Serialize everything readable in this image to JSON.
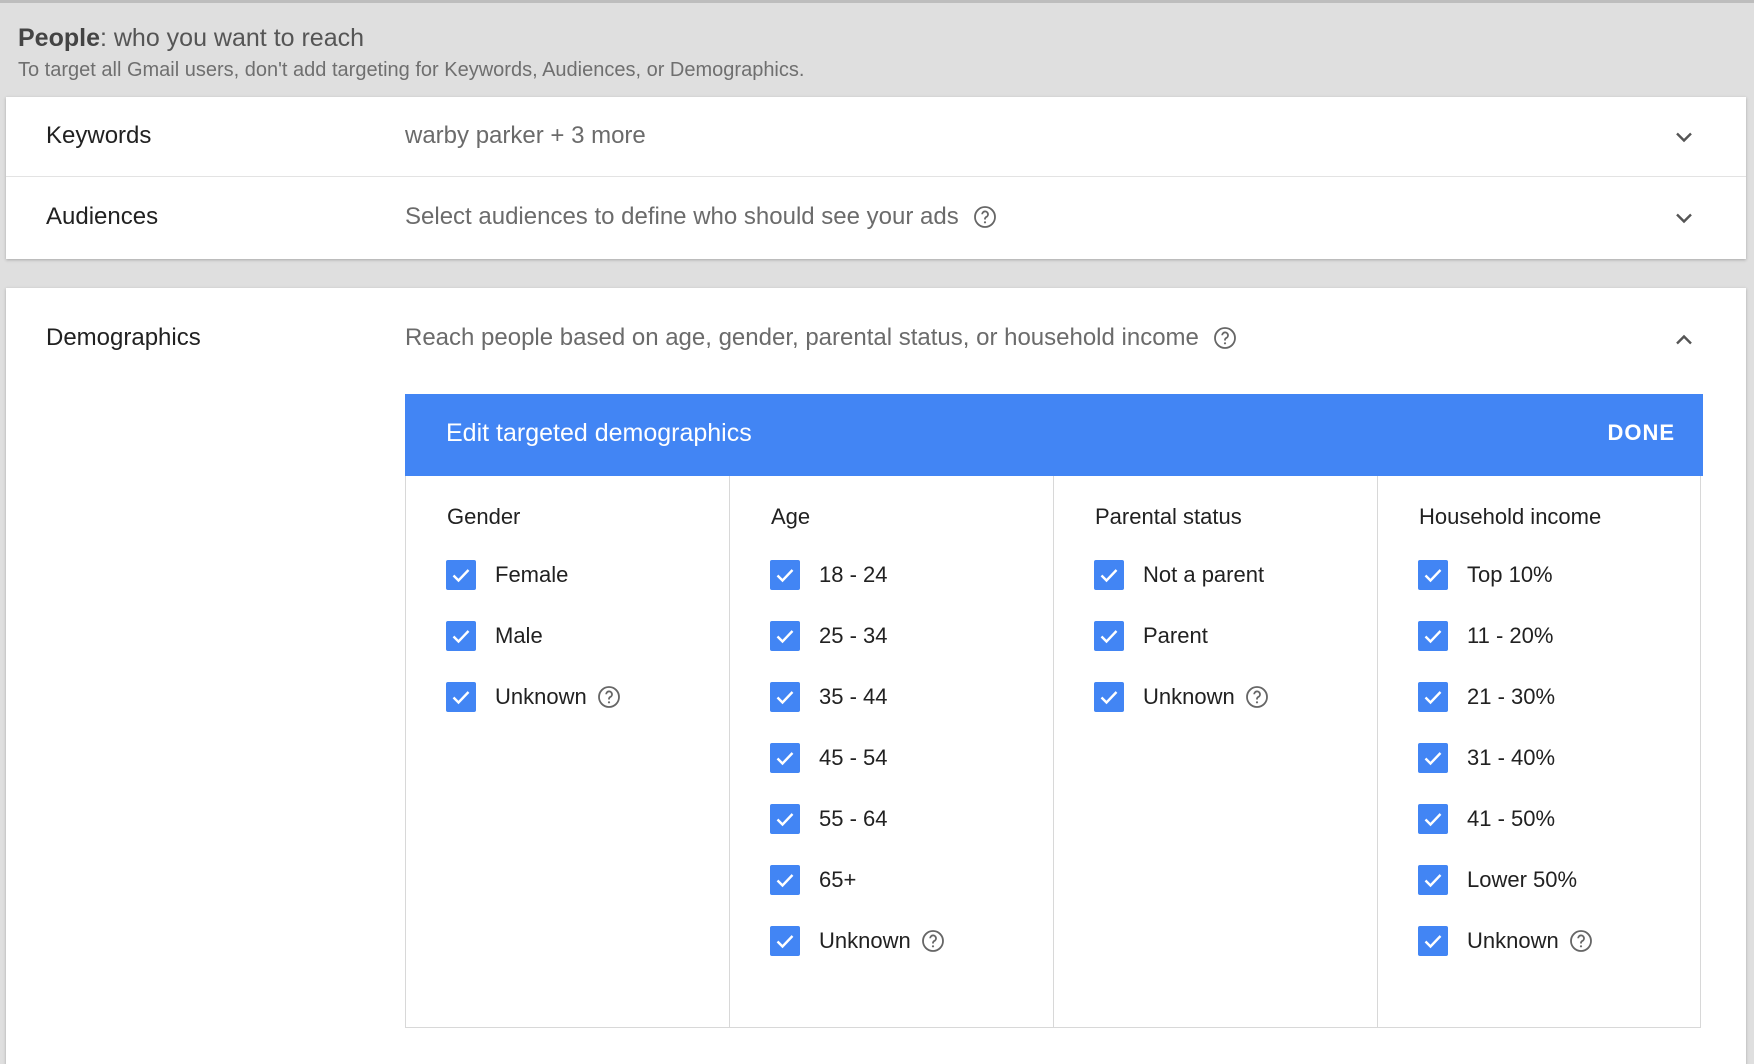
{
  "people": {
    "title_bold": "People",
    "title_rest": ": who you want to reach",
    "subtitle": "To target all Gmail users, don't add targeting for Keywords, Audiences, or Demographics."
  },
  "keywords": {
    "label": "Keywords",
    "value": "warby parker + 3 more"
  },
  "audiences": {
    "label": "Audiences",
    "value": "Select audiences to define who should see your ads"
  },
  "demographics": {
    "label": "Demographics",
    "value": "Reach people based on age, gender, parental status, or household income",
    "editor_title": "Edit targeted demographics",
    "done_label": "DONE",
    "accent_color": "#4285f4",
    "columns": [
      {
        "heading": "Gender",
        "options": [
          {
            "label": "Female",
            "checked": true,
            "help": false
          },
          {
            "label": "Male",
            "checked": true,
            "help": false
          },
          {
            "label": "Unknown",
            "checked": true,
            "help": true
          }
        ]
      },
      {
        "heading": "Age",
        "options": [
          {
            "label": "18 - 24",
            "checked": true,
            "help": false
          },
          {
            "label": "25 - 34",
            "checked": true,
            "help": false
          },
          {
            "label": "35 - 44",
            "checked": true,
            "help": false
          },
          {
            "label": "45 - 54",
            "checked": true,
            "help": false
          },
          {
            "label": "55 - 64",
            "checked": true,
            "help": false
          },
          {
            "label": "65+",
            "checked": true,
            "help": false
          },
          {
            "label": "Unknown",
            "checked": true,
            "help": true
          }
        ]
      },
      {
        "heading": "Parental status",
        "options": [
          {
            "label": "Not a parent",
            "checked": true,
            "help": false
          },
          {
            "label": "Parent",
            "checked": true,
            "help": false
          },
          {
            "label": "Unknown",
            "checked": true,
            "help": true
          }
        ]
      },
      {
        "heading": "Household income",
        "options": [
          {
            "label": "Top 10%",
            "checked": true,
            "help": false
          },
          {
            "label": "11 - 20%",
            "checked": true,
            "help": false
          },
          {
            "label": "21 - 30%",
            "checked": true,
            "help": false
          },
          {
            "label": "31 - 40%",
            "checked": true,
            "help": false
          },
          {
            "label": "41 - 50%",
            "checked": true,
            "help": false
          },
          {
            "label": "Lower 50%",
            "checked": true,
            "help": false
          },
          {
            "label": "Unknown",
            "checked": true,
            "help": true
          }
        ]
      }
    ]
  },
  "icons": {
    "expand": "chevron-down-icon",
    "collapse": "chevron-up-icon",
    "help": "help-circle-icon",
    "check": "checkmark-icon"
  }
}
